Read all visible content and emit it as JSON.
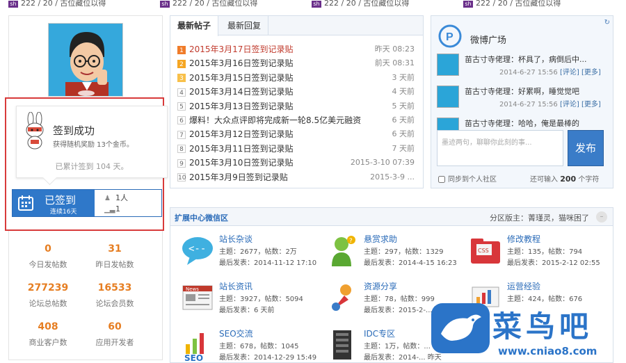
{
  "topbar": {
    "items": [
      {
        "text": "222 / 20 / 古位藏位以得"
      },
      {
        "text": "222 / 20 / 古位藏位以得"
      },
      {
        "text": "222 / 20 / 古位藏位以得"
      },
      {
        "text": "222 / 20 / 古位藏位以得"
      }
    ]
  },
  "signin": {
    "success_title": "签到成功",
    "success_sub": "获得随机奖励 13个金币。",
    "total_text": "已累计签到 104 天。",
    "button_label": "已签到",
    "streak_text": "连续16天",
    "people_count": "1人",
    "rank_count": "1"
  },
  "stats": [
    {
      "value": "0",
      "label": "今日发帖数"
    },
    {
      "value": "31",
      "label": "昨日发帖数"
    },
    {
      "value": "277239",
      "label": "论坛总帖数"
    },
    {
      "value": "16533",
      "label": "论坛会员数"
    },
    {
      "value": "408",
      "label": "商业客户数"
    },
    {
      "value": "60",
      "label": "应用开发者"
    }
  ],
  "news": {
    "tabs": [
      "最新帖子",
      "最新回复"
    ],
    "items": [
      {
        "num": "1",
        "title": "2015年3月17日签到记录贴",
        "time": "昨天 08:23",
        "red": true
      },
      {
        "num": "2",
        "title": "2015年3月16日签到记录贴",
        "time": "前天 08:31",
        "red": false
      },
      {
        "num": "3",
        "title": "2015年3月15日签到记录贴",
        "time": "3 天前",
        "red": false
      },
      {
        "num": "4",
        "title": "2015年3月14日签到记录贴",
        "time": "4 天前",
        "red": false
      },
      {
        "num": "5",
        "title": "2015年3月13日签到记录贴",
        "time": "5 天前",
        "red": false
      },
      {
        "num": "6",
        "title": "爆料！大众点评即将完成新一轮8.5亿美元融资",
        "time": "6 天前",
        "red": false
      },
      {
        "num": "7",
        "title": "2015年3月12日签到记录贴",
        "time": "6 天前",
        "red": false
      },
      {
        "num": "8",
        "title": "2015年3月11日签到记录贴",
        "time": "7 天前",
        "red": false
      },
      {
        "num": "9",
        "title": "2015年3月10日签到记录贴",
        "time": "2015-3-10 07:39",
        "red": false
      },
      {
        "num": "10",
        "title": "2015年3月9日签到记录贴",
        "time": "2015-3-9 ...",
        "red": false
      }
    ]
  },
  "weibo": {
    "title": "微博广场",
    "items": [
      {
        "text": "苗古寸寺佬理：杯具了，病倒后中...",
        "time": "2014-6-27 15:56",
        "comment": "[评论]",
        "more": "[更多]"
      },
      {
        "text": "苗古寸寺佬理：好累啊，睡觉觉吧",
        "time": "2014-6-27 15:56",
        "comment": "[评论]",
        "more": "[更多]"
      },
      {
        "text": "苗古寸寺佬理：哈哈，俺是最棒的",
        "time": "",
        "comment": "",
        "more": ""
      }
    ],
    "placeholder": "墨迹两句，聊聊你此刻的事...",
    "post_button": "发布",
    "sync_label": "同步到个人社区",
    "count_prefix": "还可输入",
    "count_value": "200",
    "count_suffix": "个字符"
  },
  "forum": {
    "title": "扩展中心微信区",
    "right_text": "分区版主：菁瑾灵，猫咪困了",
    "sections": [
      {
        "name": "站长杂谈",
        "line1": "主题：2677，帖数：2万",
        "line2": "最后发表：2014-11-12 17:10",
        "icon": "chat-bubble-icon"
      },
      {
        "name": "悬赏求助",
        "line1": "主题：297，帖数：1329",
        "line2": "最后发表：2014-4-15 16:23",
        "icon": "help-person-icon"
      },
      {
        "name": "修改教程",
        "line1": "主题：135，帖数：794",
        "line2": "最后发表：2015-2-12 02:55",
        "icon": "css-folder-icon"
      },
      {
        "name": "站长资讯",
        "line1": "主题：3927，帖数：5094",
        "line2": "最后发表：6 天前",
        "icon": "newspaper-icon"
      },
      {
        "name": "资源分享",
        "line1": "主题：78，帖数：999",
        "line2": "最后发表：2015-2-...",
        "icon": "share-rocket-icon"
      },
      {
        "name": "运营经验",
        "line1": "主题：424，帖数：676",
        "line2": "",
        "icon": "chart-board-icon"
      },
      {
        "name": "SEO交流",
        "line1": "主题：678，帖数：1045",
        "line2": "最后发表：2014-12-29 15:49",
        "icon": "seo-chart-icon"
      },
      {
        "name": "IDC专区",
        "line1": "主题：1万，帖数：...",
        "line2": "最后发表：2014-... 昨天",
        "icon": "server-rack-icon"
      }
    ]
  },
  "watermark": {
    "cn_text": "菜鸟吧",
    "url": "www.cniao8.com"
  }
}
